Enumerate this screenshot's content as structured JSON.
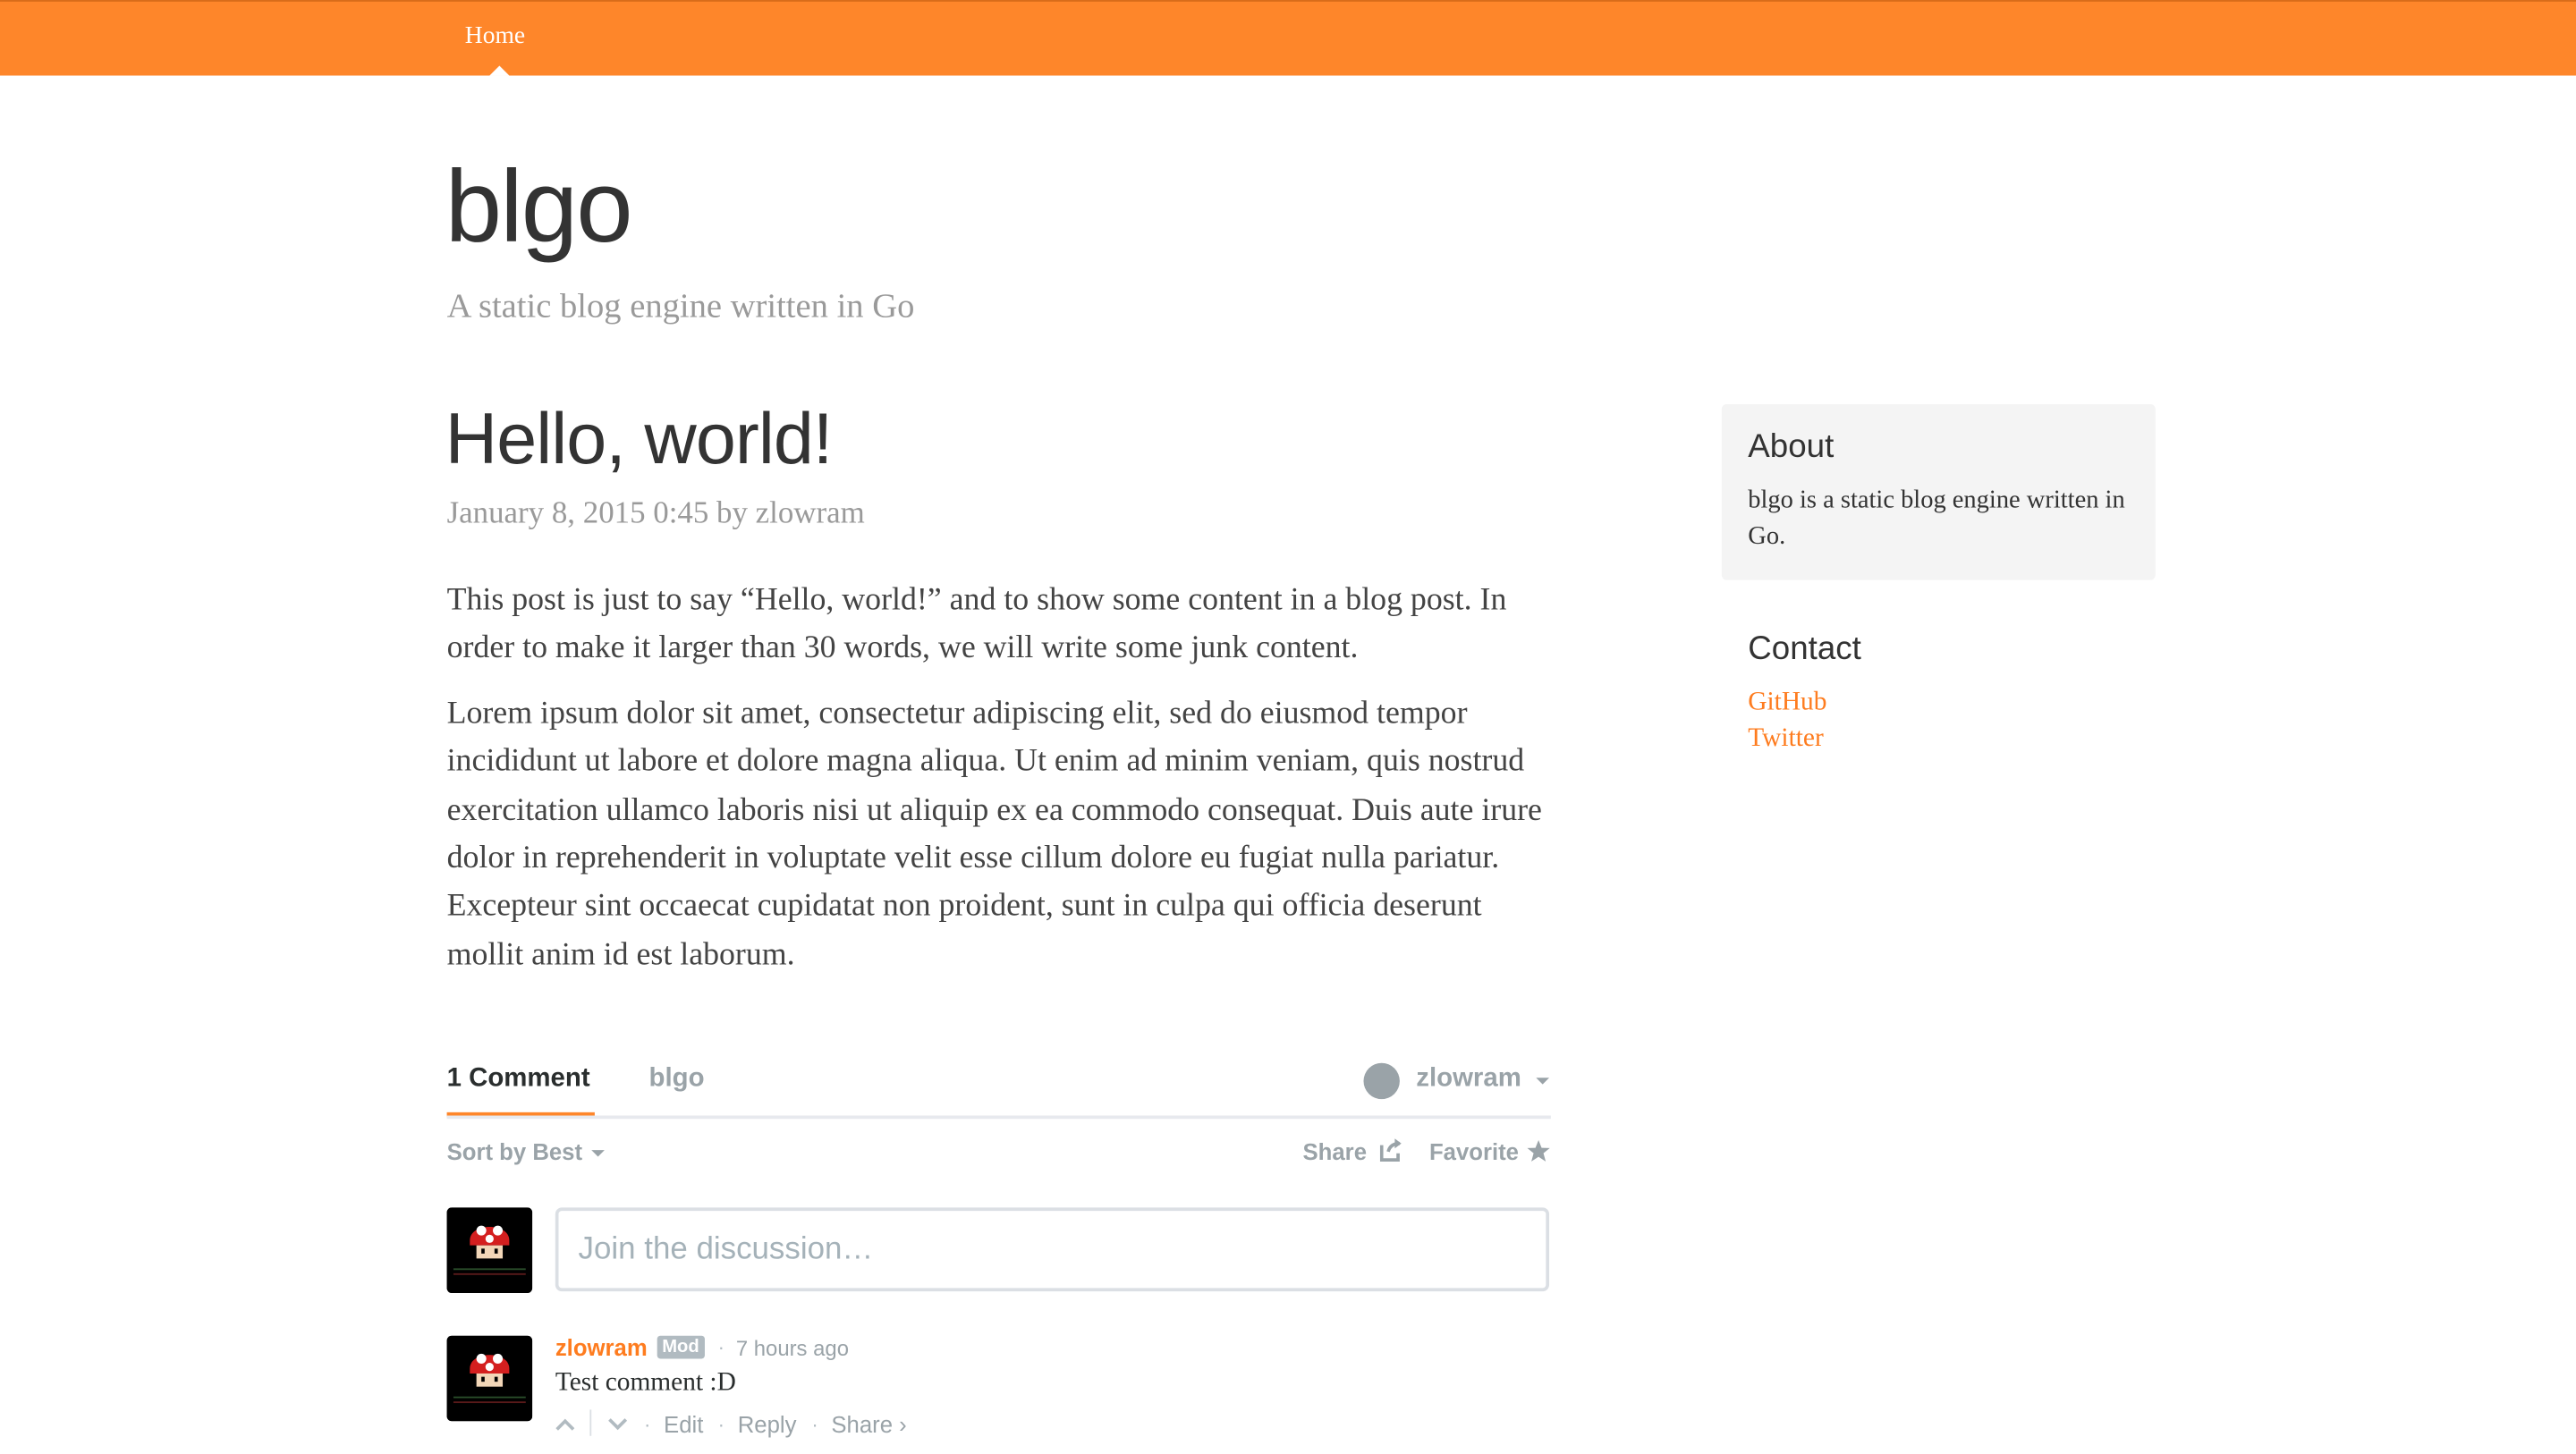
{
  "nav": {
    "home_label": "Home"
  },
  "site": {
    "title": "blgo",
    "tagline": "A static blog engine written in Go"
  },
  "post": {
    "title": "Hello, world!",
    "meta": "January 8, 2015 0:45 by zlowram",
    "paragraphs": [
      "This post is just to say “Hello, world!” and to show some content in a blog post. In order to make it larger than 30 words, we will write some junk content.",
      "Lorem ipsum dolor sit amet, consectetur adipiscing elit, sed do eiusmod tempor incididunt ut labore et dolore magna aliqua. Ut enim ad minim veniam, quis nostrud exercitation ullamco laboris nisi ut aliquip ex ea commodo consequat. Duis aute irure dolor in reprehenderit in voluptate velit esse cillum dolore eu fugiat nulla pariatur. Excepteur sint occaecat cupidatat non proident, sunt in culpa qui officia deserunt mollit anim id est laborum."
    ]
  },
  "sidebar": {
    "about_title": "About",
    "about_text": "blgo is a static blog engine written in Go.",
    "contact_title": "Contact",
    "links": [
      {
        "label": "GitHub"
      },
      {
        "label": "Twitter"
      }
    ]
  },
  "comments": {
    "tab_count_label": "1 Comment",
    "tab_forum_label": "blgo",
    "user_label": "zlowram",
    "sort_label": "Sort by Best",
    "share_label": "Share",
    "favorite_label": "Favorite",
    "input_placeholder": "Join the discussion…",
    "items": [
      {
        "author": "zlowram",
        "badge": "Mod",
        "separator": "·",
        "time": "7 hours ago",
        "text": "Test comment :D",
        "edit_label": "Edit",
        "reply_label": "Reply",
        "share_label": "Share ›"
      }
    ]
  },
  "colors": {
    "accent": "#fe862a",
    "link": "#fe7c1f",
    "muted": "#9aa3a8",
    "sidebar_bg": "#f4f4f4"
  }
}
